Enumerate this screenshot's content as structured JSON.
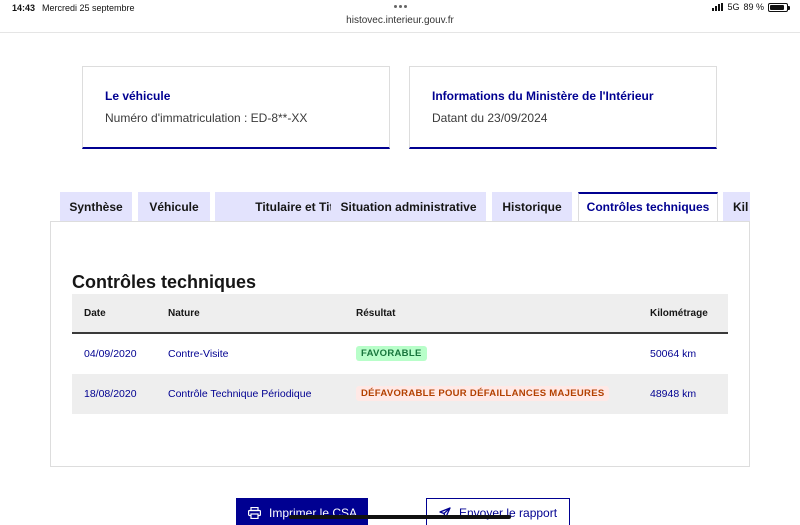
{
  "status_bar": {
    "time": "14:43",
    "date": "Mercredi 25 septembre",
    "network": "5G",
    "battery": "89 %",
    "battery_level": 0.89
  },
  "browser": {
    "url": "histovec.interieur.gouv.fr"
  },
  "cards": {
    "vehicle": {
      "title": "Le véhicule",
      "value": "Numéro d'immatriculation : ED-8**-XX"
    },
    "ministry": {
      "title": "Informations du Ministère de l'Intérieur",
      "value": "Datant du 23/09/2024"
    }
  },
  "tabs": [
    {
      "label": "Synthèse"
    },
    {
      "label": "Véhicule"
    },
    {
      "label": "Titulaire et Titre"
    },
    {
      "label": "Situation administrative"
    },
    {
      "label": "Historique"
    },
    {
      "label": "Contrôles techniques",
      "active": true
    },
    {
      "label": "Kil"
    }
  ],
  "section": {
    "title": "Contrôles techniques",
    "columns": {
      "date": "Date",
      "nature": "Nature",
      "result": "Résultat",
      "mileage": "Kilométrage"
    },
    "rows": [
      {
        "date": "04/09/2020",
        "nature": "Contre-Visite",
        "result": "FAVORABLE",
        "result_status": "favorable",
        "mileage": "50064 km"
      },
      {
        "date": "18/08/2020",
        "nature": "Contrôle Technique Périodique",
        "result": "DÉFAVORABLE POUR DÉFAILLANCES MAJEURES",
        "result_status": "defavorable",
        "mileage": "48948 km"
      }
    ]
  },
  "actions": {
    "print": {
      "label": "Imprimer le CSA",
      "icon": "printer-icon"
    },
    "send": {
      "label": "Envoyer le rapport",
      "icon": "send-icon"
    }
  },
  "colors": {
    "primary": "#000091",
    "success": "#18753c",
    "error": "#b34000",
    "tab_inactive": "#e3e3fd"
  }
}
